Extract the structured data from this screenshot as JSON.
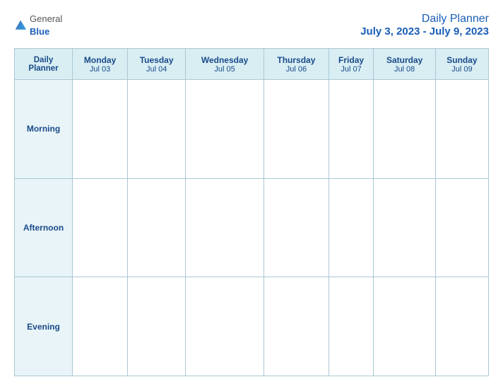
{
  "logo": {
    "general": "General",
    "blue": "Blue",
    "icon_label": "generalblue-logo"
  },
  "header": {
    "title": "Daily Planner",
    "date_range": "July 3, 2023 - July 9, 2023"
  },
  "table": {
    "label_col_header_line1": "Daily",
    "label_col_header_line2": "Planner",
    "days": [
      {
        "name": "Monday",
        "date": "Jul 03"
      },
      {
        "name": "Tuesday",
        "date": "Jul 04"
      },
      {
        "name": "Wednesday",
        "date": "Jul 05"
      },
      {
        "name": "Thursday",
        "date": "Jul 06"
      },
      {
        "name": "Friday",
        "date": "Jul 07"
      },
      {
        "name": "Saturday",
        "date": "Jul 08"
      },
      {
        "name": "Sunday",
        "date": "Jul 09"
      }
    ],
    "rows": [
      {
        "label": "Morning"
      },
      {
        "label": "Afternoon"
      },
      {
        "label": "Evening"
      }
    ]
  }
}
